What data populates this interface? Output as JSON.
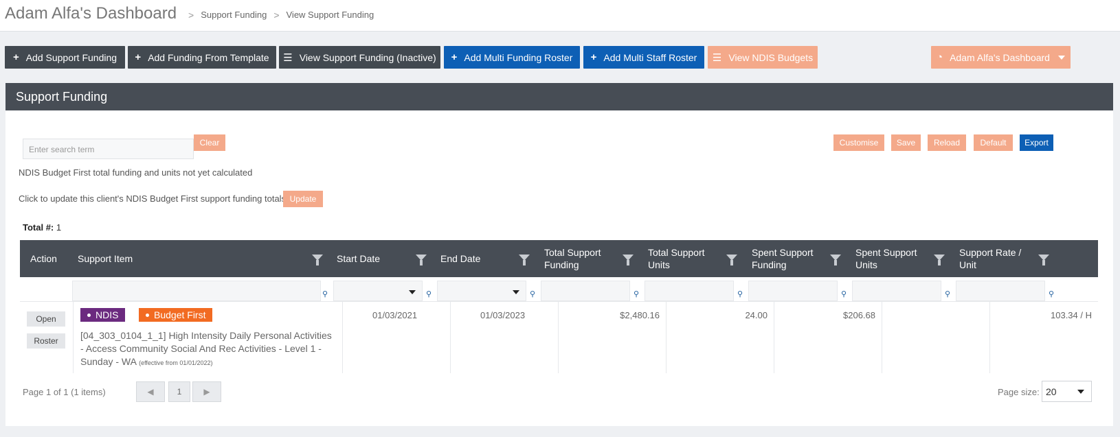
{
  "header": {
    "title": "Adam Alfa's Dashboard",
    "breadcrumb": [
      "Support Funding",
      "View Support Funding"
    ],
    "separator": ">"
  },
  "toolbar": {
    "add_support_funding": "Add Support Funding",
    "add_funding_template": "Add Funding From Template",
    "view_inactive": "View Support Funding (Inactive)",
    "add_multi_funding_roster": "Add Multi Funding Roster",
    "add_multi_staff_roster": "Add Multi Staff Roster",
    "view_ndis_budgets": "View NDIS Budgets",
    "dashboard_dropdown": "Adam Alfa's Dashboard"
  },
  "panel": {
    "title": "Support Funding",
    "search_placeholder": "Enter search term",
    "clear": "Clear",
    "customise": "Customise",
    "save": "Save",
    "reload": "Reload",
    "default": "Default",
    "export": "Export",
    "note_calculated": "NDIS Budget First total funding and units not yet calculated",
    "note_update": "Click to update this client's NDIS Budget First support funding totals:",
    "update": "Update",
    "total_label": "Total #:",
    "total_value": "1"
  },
  "table": {
    "columns": {
      "action": "Action",
      "support_item": "Support Item",
      "start_date": "Start Date",
      "end_date": "End Date",
      "total_funding": "Total Support Funding",
      "total_units": "Total Support Units",
      "spent_funding": "Spent Support Funding",
      "spent_units": "Spent Support Units",
      "rate": "Support Rate / Unit"
    },
    "row": {
      "open": "Open",
      "roster": "Roster",
      "badge1": "NDIS",
      "badge2": "Budget First",
      "item": "[04_303_0104_1_1] High Intensity Daily Personal Activities - Access Community Social And Rec Activities - Level 1 - Sunday - WA",
      "effective": "(effective from 01/01/2022)",
      "start_date": "01/03/2021",
      "end_date": "01/03/2023",
      "total_funding": "$2,480.16",
      "total_units": "24.00",
      "spent_funding": "$206.68",
      "spent_units": "",
      "rate": "103.34 / H"
    }
  },
  "pager": {
    "info": "Page 1 of 1 (1 items)",
    "current": "1",
    "page_size_label": "Page size:",
    "page_size": "20"
  },
  "colors": {
    "dark": "#424950",
    "blue": "#0d5fb5",
    "peach": "#f4a98a",
    "ndis_badge": "#6b2a7f",
    "budget_badge": "#f26b22"
  }
}
